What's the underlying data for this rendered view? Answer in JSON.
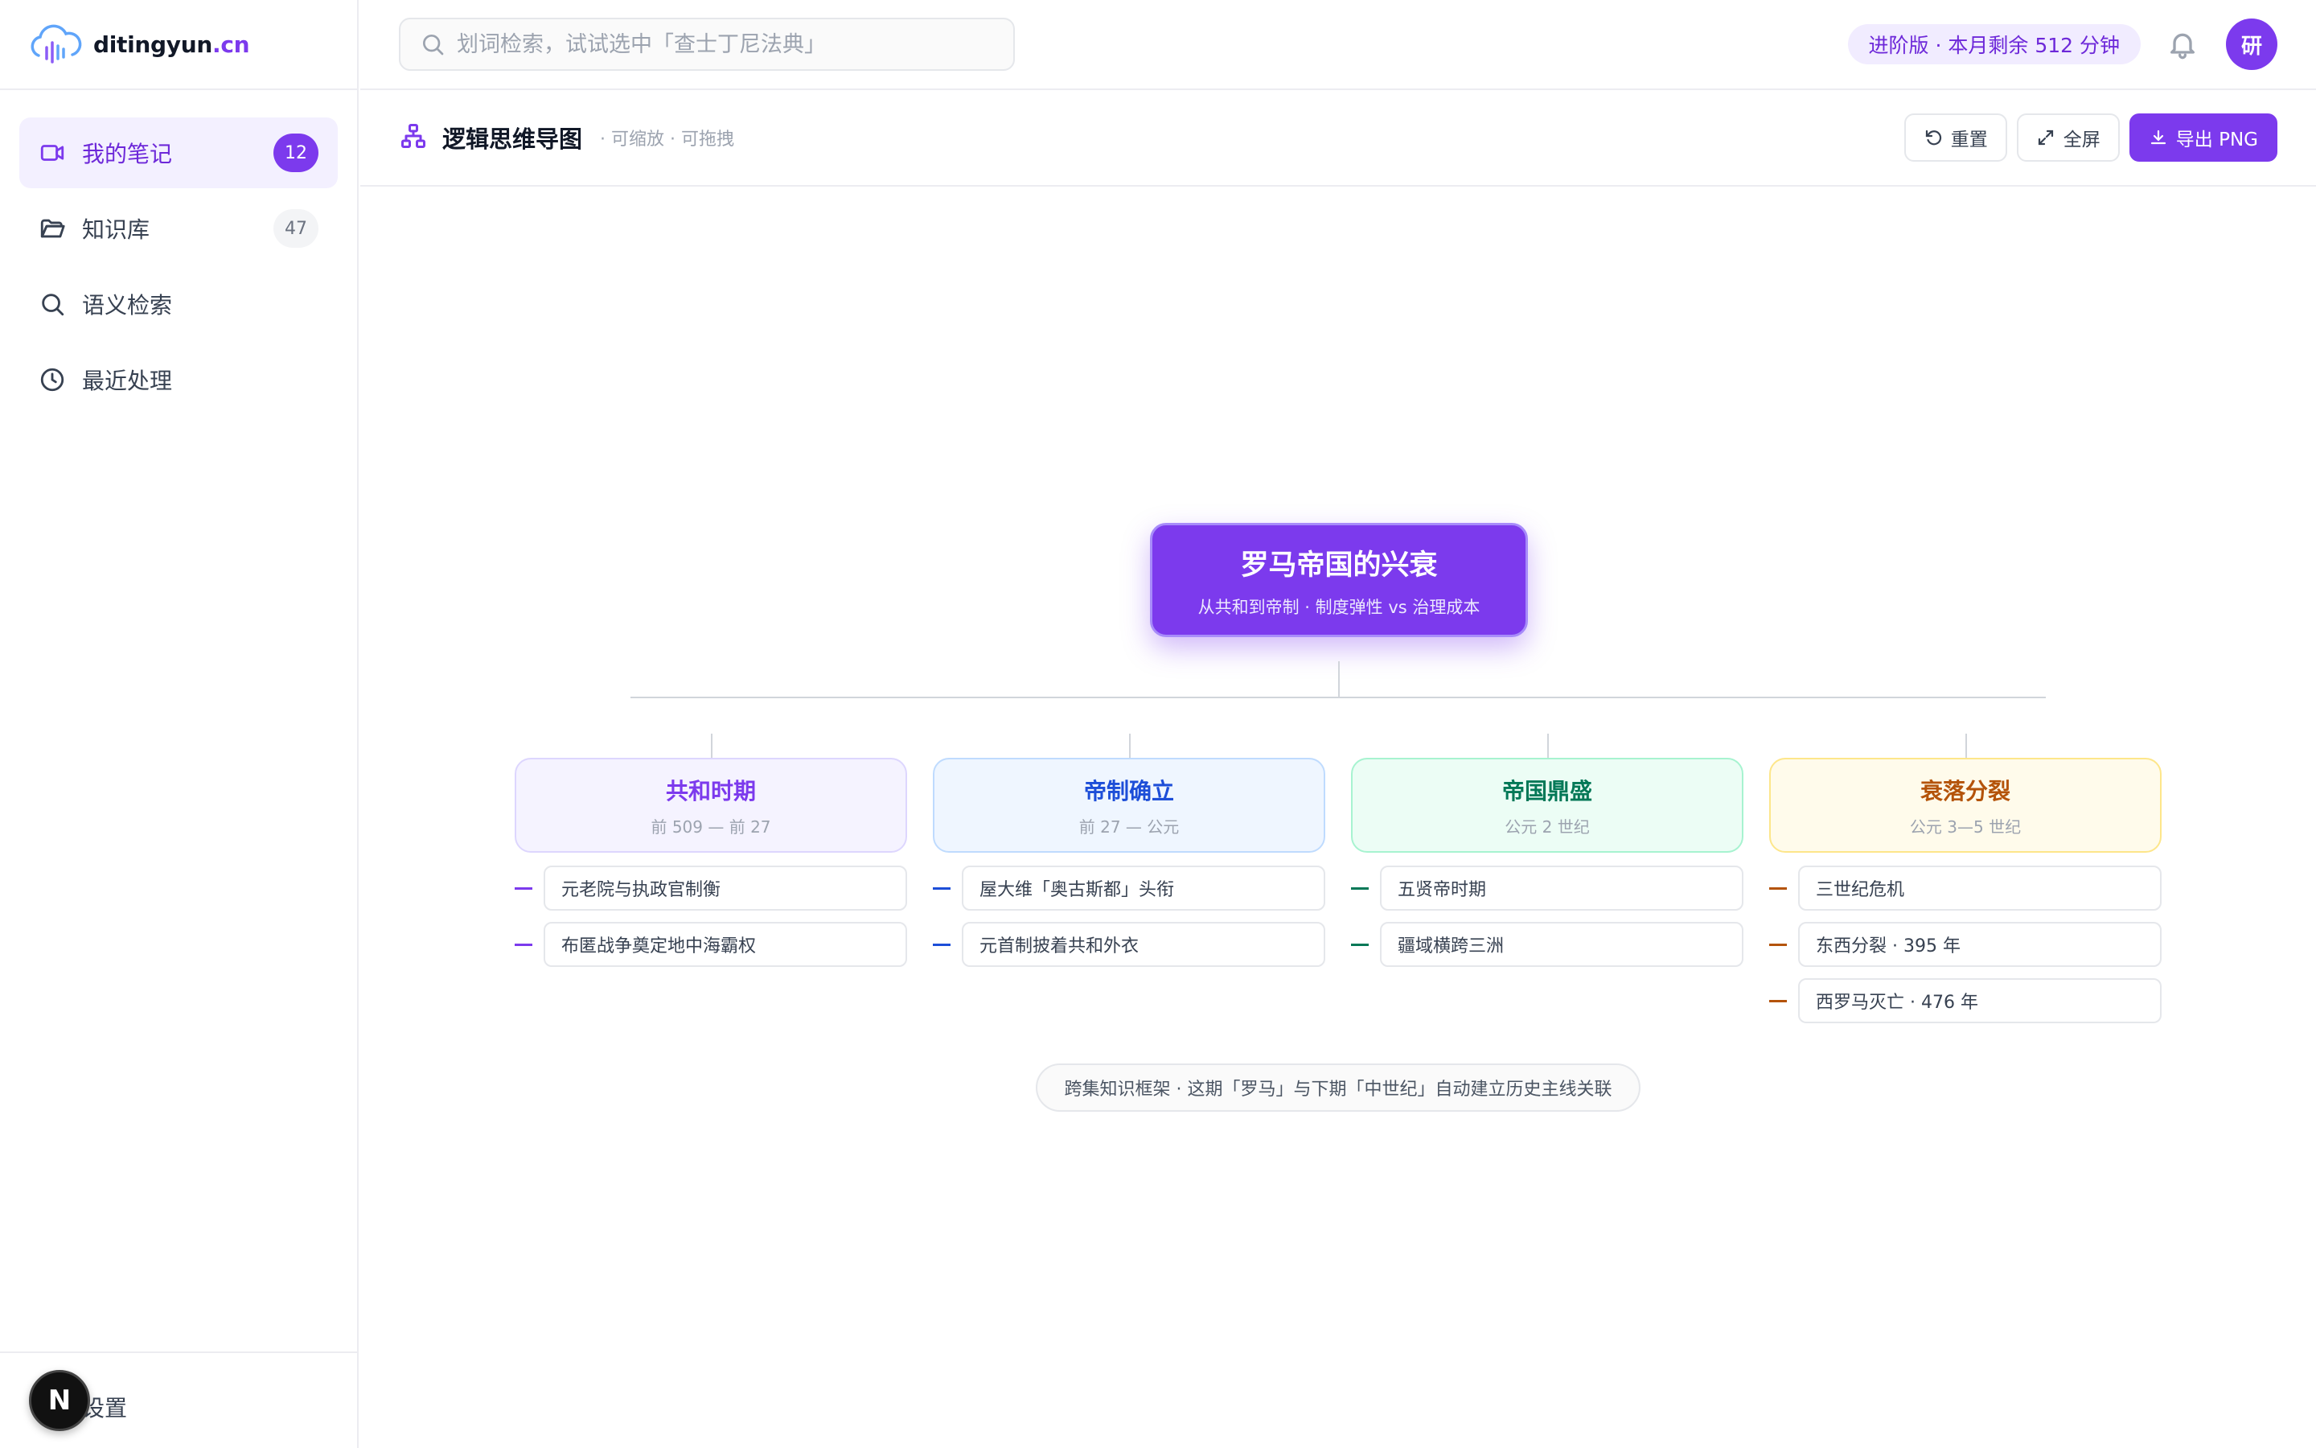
{
  "brand": {
    "name": "ditingyun",
    "tld": ".cn"
  },
  "sidebar": {
    "items": [
      {
        "label": "我的笔记",
        "count": "12"
      },
      {
        "label": "知识库",
        "count": "47"
      },
      {
        "label": "语义检索"
      },
      {
        "label": "最近处理"
      }
    ],
    "footer": {
      "badge": "N",
      "settings_label": "设置"
    }
  },
  "topbar": {
    "search_placeholder": "划词检索，试试选中「查士丁尼法典」",
    "plan": "进阶版 · 本月剩余 512 分钟",
    "avatar": "研"
  },
  "subheader": {
    "title": "逻辑思维导图",
    "hint": "· 可缩放 · 可拖拽",
    "buttons": {
      "reset": "重置",
      "fullscreen": "全屏",
      "export": "导出 PNG"
    }
  },
  "mindmap": {
    "root": {
      "title": "罗马帝国的兴衰",
      "subtitle": "从共和到帝制 · 制度弹性 vs 治理成本"
    },
    "branches": [
      {
        "title": "共和时期",
        "period": "前 509 — 前 27",
        "color": "#7c3aed",
        "bg": "#f5f3ff",
        "border": "#ddd6fe",
        "leaves": [
          "元老院与执政官制衡",
          "布匿战争奠定地中海霸权"
        ]
      },
      {
        "title": "帝制确立",
        "period": "前 27 — 公元",
        "color": "#1d4ed8",
        "bg": "#eff6ff",
        "border": "#bfdbfe",
        "leaves": [
          "屋大维「奥古斯都」头衔",
          "元首制披着共和外衣"
        ]
      },
      {
        "title": "帝国鼎盛",
        "period": "公元 2 世纪",
        "color": "#047857",
        "bg": "#ecfdf5",
        "border": "#a7f3d0",
        "leaves": [
          "五贤帝时期",
          "疆域横跨三洲"
        ]
      },
      {
        "title": "衰落分裂",
        "period": "公元 3—5 世纪",
        "color": "#b45309",
        "bg": "#fffbeb",
        "border": "#fde68a",
        "leaves": [
          "三世纪危机",
          "东西分裂 · 395 年",
          "西罗马灭亡 · 476 年"
        ]
      }
    ],
    "note": "跨集知识框架 · 这期「罗马」与下期「中世纪」自动建立历史主线关联"
  },
  "colors": {
    "accent": "#7c3aed"
  }
}
